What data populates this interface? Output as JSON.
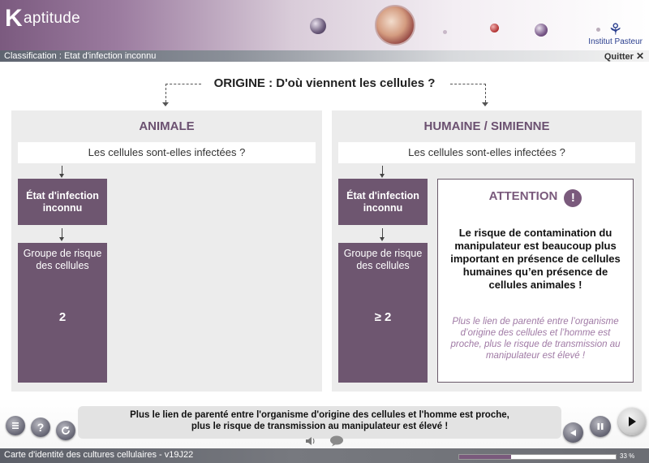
{
  "header": {
    "logo_initial": "K",
    "logo_rest": "aptitude",
    "partner": "Institut Pasteur"
  },
  "subbar": {
    "title": "Classification : Etat d'infection inconnu",
    "quit_label": "Quitter",
    "quit_icon": "✕"
  },
  "origin_title": "ORIGINE : D'où viennent les cellules ?",
  "left_panel": {
    "heading": "ANIMALE",
    "question": "Les cellules sont-elles infectées ?",
    "state_box": "État d'infection inconnu",
    "risk_box_label": "Groupe de risque des cellules",
    "risk_value": "2"
  },
  "right_panel": {
    "heading": "HUMAINE / SIMIENNE",
    "question": "Les cellules sont-elles infectées ?",
    "state_box": "État d'infection inconnu",
    "risk_box_label": "Groupe de risque des cellules",
    "risk_value": "≥ 2",
    "attention": {
      "title": "ATTENTION",
      "icon": "!",
      "body": "Le risque de contamination du manipulateur est beaucoup plus important en présence de cellules humaines qu’en présence de cellules animales !",
      "note": "Plus le lien de parenté entre l’organisme d’origine des cellules et l’homme est proche, plus le risque de transmission au manipulateur est élevé !"
    }
  },
  "caption": {
    "line1": "Plus le lien de parenté entre l'organisme d'origine des cellules et l'homme est proche,",
    "line2": "plus le risque de transmission au manipulateur est élevé !"
  },
  "footer": {
    "course_title": "Carte d'identité des cultures cellulaires - v19J22",
    "progress_percent": 33,
    "progress_label": "33 %"
  },
  "colors": {
    "accent": "#6e5670",
    "accent_light": "#a07aa5",
    "panel_bg": "#ececec"
  }
}
